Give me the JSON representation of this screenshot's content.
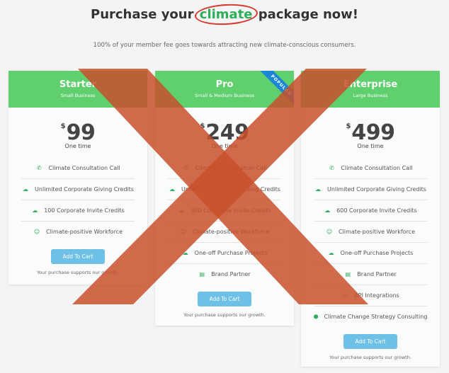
{
  "header": {
    "title_before": "Purchase your",
    "title_highlight": "climate",
    "title_after": "package now!",
    "subtitle": "100% of your member fee goes towards attracting new climate-conscious consumers."
  },
  "plans": [
    {
      "name": "Starter",
      "tagline": "Small Business",
      "currency": "$",
      "price": "99",
      "period": "One time",
      "features": [
        {
          "icon": "phone-icon",
          "label": "Climate Consultation Call"
        },
        {
          "icon": "cloud-money-icon",
          "label": "Unlimited Corporate Giving Credits"
        },
        {
          "icon": "cloud-money-icon",
          "label": "100 Corporate Invite Credits"
        },
        {
          "icon": "smile-icon",
          "label": "Climate-positive Workforce"
        }
      ],
      "button": "Add To Cart",
      "note": "Your purchase supports our growth."
    },
    {
      "name": "Pro",
      "tagline": "Small & Medium Business",
      "ribbon": "POPULAR",
      "currency": "$",
      "price": "249",
      "period": "One time",
      "features": [
        {
          "icon": "phone-icon",
          "label": "Climate Consultation Call"
        },
        {
          "icon": "cloud-money-icon",
          "label": "Unlimited Corporate Giving Credits"
        },
        {
          "icon": "cloud-money-icon",
          "label": "300 Corporate Invite Credits"
        },
        {
          "icon": "smile-icon",
          "label": "Climate-positive Workforce"
        },
        {
          "icon": "cloud-money-icon",
          "label": "One-off Purchase Projects"
        },
        {
          "icon": "id-card-icon",
          "label": "Brand Partner"
        }
      ],
      "button": "Add To Cart",
      "note": "Your purchase supports our growth."
    },
    {
      "name": "Enterprise",
      "tagline": "Large Business",
      "currency": "$",
      "price": "499",
      "period": "One time",
      "features": [
        {
          "icon": "phone-icon",
          "label": "Climate Consultation Call"
        },
        {
          "icon": "cloud-money-icon",
          "label": "Unlimited Corporate Giving Credits"
        },
        {
          "icon": "cloud-money-icon",
          "label": "600 Corporate Invite Credits"
        },
        {
          "icon": "smile-icon",
          "label": "Climate-positive Workforce"
        },
        {
          "icon": "cloud-money-icon",
          "label": "One-off Purchase Projects"
        },
        {
          "icon": "id-card-icon",
          "label": "Brand Partner"
        },
        {
          "icon": "code-icon",
          "label": "API Integrations"
        },
        {
          "icon": "shield-icon",
          "label": "Climate Change Strategy Consulting"
        }
      ],
      "button": "Add To Cart",
      "note": "Your purchase supports our growth."
    }
  ],
  "colors": {
    "header_green": "#60cf6d",
    "accent_green": "#2eae5a",
    "button_blue": "#6ec0e7",
    "ribbon_blue": "#1c86d6",
    "cross_overlay": "#c8502c",
    "circle_red": "#d9362b"
  }
}
